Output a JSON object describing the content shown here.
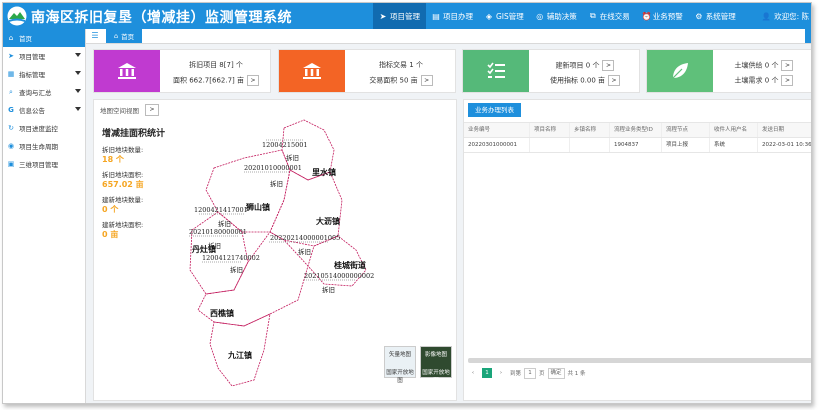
{
  "header": {
    "title": "南海区拆旧复垦（增减挂）监测管理系统",
    "nav": [
      {
        "label": "项目管理",
        "icon": "send-icon",
        "active": true
      },
      {
        "label": "项目办理",
        "icon": "document-icon",
        "active": false
      },
      {
        "label": "GIS管理",
        "icon": "layers-icon",
        "active": false
      },
      {
        "label": "辅助决策",
        "icon": "globe-icon",
        "active": false
      },
      {
        "label": "在线交易",
        "icon": "share-icon",
        "active": false
      },
      {
        "label": "业务预警",
        "icon": "alarm-icon",
        "active": false
      },
      {
        "label": "系统管理",
        "icon": "gear-icon",
        "active": false
      }
    ],
    "user_label": "欢迎您: 陈"
  },
  "sidebar": {
    "items": [
      {
        "label": "首页",
        "icon": "home-icon",
        "active": true,
        "has_caret": false
      },
      {
        "label": "项目管理",
        "icon": "send-icon",
        "active": false,
        "has_caret": true
      },
      {
        "label": "指标管理",
        "icon": "grid-icon",
        "active": false,
        "has_caret": true
      },
      {
        "label": "查询与汇总",
        "icon": "search-icon",
        "active": false,
        "has_caret": true
      },
      {
        "label": "信息公告",
        "icon": "google-icon",
        "active": false,
        "has_caret": true
      },
      {
        "label": "项目进度监控",
        "icon": "refresh-icon",
        "active": false,
        "has_caret": false
      },
      {
        "label": "项目生命周期",
        "icon": "cycle-icon",
        "active": false,
        "has_caret": false
      },
      {
        "label": "三维项目管理",
        "icon": "cube-icon",
        "active": false,
        "has_caret": false
      }
    ]
  },
  "tabs": {
    "home_label": "首页"
  },
  "cards": [
    {
      "line1": "拆旧项目 8[7] 个",
      "line2": "面积 662.7[662.7] 亩",
      "color": "#c03ad0",
      "icon": "bank-icon",
      "btn1": false,
      "btn2": true
    },
    {
      "line1": "指标交易 1 个",
      "line2": "交易面积 50 亩",
      "color": "#f36425",
      "icon": "bank-icon",
      "btn1": false,
      "btn2": true
    },
    {
      "line1": "建新项目 0 个",
      "line2": "使用指标 0.00 亩",
      "color": "#55b979",
      "icon": "checklist-icon",
      "btn1": true,
      "btn2": true
    },
    {
      "line1": "土壤供给 0 个",
      "line2": "土壤需求 0 个",
      "color": "#5fc07a",
      "icon": "leaf-icon",
      "btn1": true,
      "btn2": true
    }
  ],
  "map_panel": {
    "head_label": "地图空间视图",
    "stats_title": "增减挂面积统计",
    "stats": [
      {
        "label": "拆旧地块数量:",
        "value": "18 个"
      },
      {
        "label": "拆旧地块面积:",
        "value": "657.02 亩"
      },
      {
        "label": "建新地块数量:",
        "value": "0 个"
      },
      {
        "label": "建新地块面积:",
        "value": "0 亩"
      }
    ],
    "towns": [
      {
        "name": "里水镇"
      },
      {
        "name": "狮山镇"
      },
      {
        "name": "大沥镇"
      },
      {
        "name": "丹灶镇"
      },
      {
        "name": "桂城街道"
      },
      {
        "name": "西樵镇"
      },
      {
        "name": "九江镇"
      }
    ],
    "plot_codes": [
      "12004215001",
      "20201010000001",
      "1200421417001",
      "20210180000001",
      "12004121740002",
      "20220214000001005",
      "20210514000000002"
    ],
    "plot_type_label": "拆旧",
    "toggles": [
      {
        "label": "矢量地图",
        "sub": "国家开放地图"
      },
      {
        "label": "影像地图",
        "sub": "国家开放地图"
      }
    ]
  },
  "biz_panel": {
    "button_label": "业务办理列表",
    "columns": [
      "业务编号",
      "项目名称",
      "乡镇名称",
      "流程业务类型ID",
      "流程节点",
      "收件人用户名",
      "发送日期"
    ],
    "rows": [
      [
        "20220301000001",
        "",
        "",
        "1904837",
        "项目上报",
        "系统",
        "2022-03-01 10:36"
      ]
    ],
    "pager": {
      "current": "1",
      "goto_prefix": "到第",
      "goto_value": "1",
      "goto_suffix": "页",
      "confirm": "确定",
      "total": "共 1 条"
    }
  }
}
